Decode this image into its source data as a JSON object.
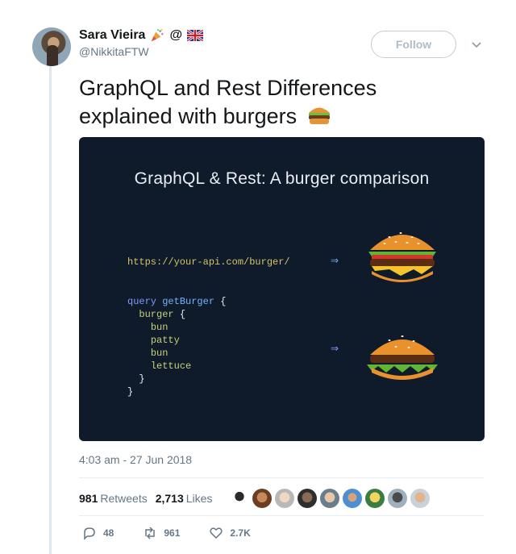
{
  "user": {
    "name": "Sara Vieira",
    "at_symbol": "@",
    "handle": "@NikkitaFTW"
  },
  "follow_label": "Follow",
  "tweet": {
    "text": "GraphQL and Rest Differences explained with burgers"
  },
  "media": {
    "title": "GraphQL & Rest: A burger comparison",
    "url": "https://your-api.com/burger/",
    "arrow": "⇒",
    "query_keyword": "query",
    "query_name": "getBurger",
    "open_brace": "{",
    "close_brace": "}",
    "nested_field": "burger",
    "fields": [
      "bun",
      "patty",
      "bun",
      "lettuce"
    ]
  },
  "timestamp": "4:03 am - 27 Jun 2018",
  "stats": {
    "retweets_count": "981",
    "retweets_label": "Retweets",
    "likes_count": "2,713",
    "likes_label": "Likes"
  },
  "actions": {
    "replies": "48",
    "retweets": "961",
    "likes": "2.7K"
  },
  "colors": {
    "slide_bg": "#0f1b2a",
    "code_url": "#d6c46a",
    "keyword": "#7e9bff"
  }
}
